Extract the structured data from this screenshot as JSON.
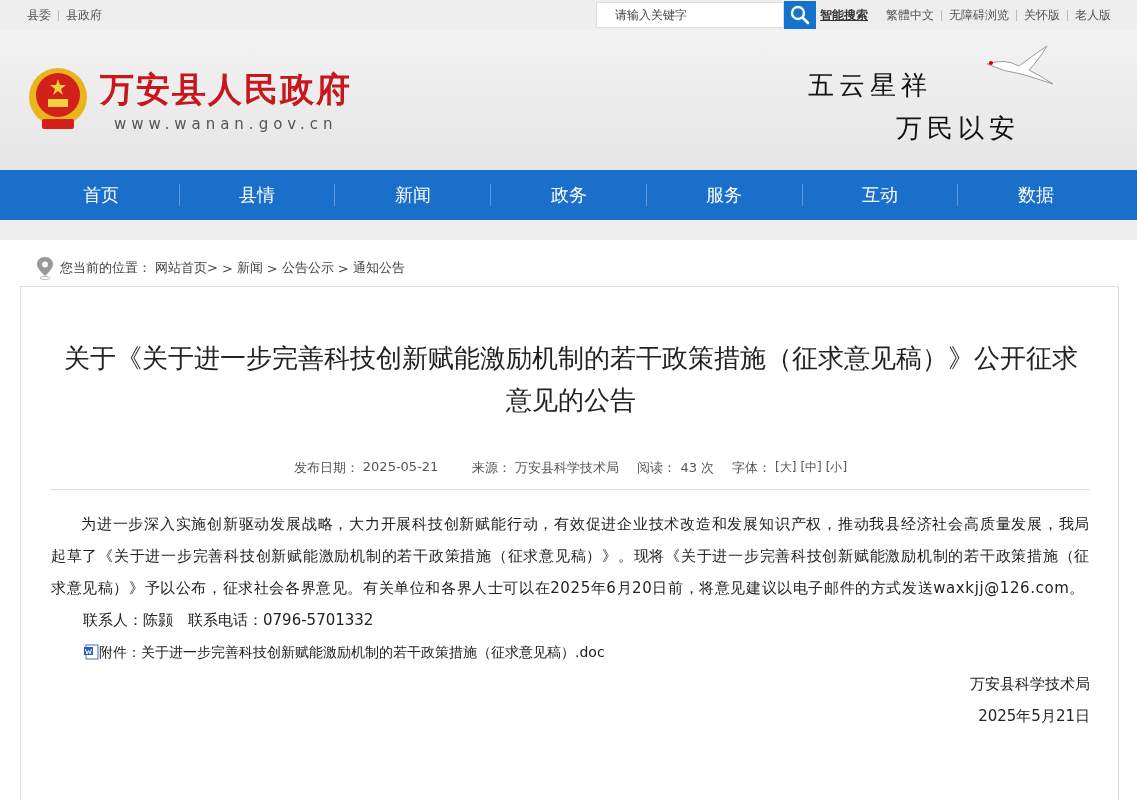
{
  "top_bar": {
    "left_links": [
      "县委",
      "县政府"
    ],
    "search": {
      "placeholder": "请输入关键字",
      "advanced_link": "智能搜索"
    },
    "right_links": [
      "繁體中文",
      "无障碍浏览",
      "关怀版",
      "老人版"
    ]
  },
  "header": {
    "site_name": "万安县人民政府",
    "domain": "www.wanan.gov.cn",
    "slogan_1": "五云星祥",
    "slogan_2": "万民以安"
  },
  "nav": [
    "首页",
    "县情",
    "新闻",
    "政务",
    "服务",
    "互动",
    "数据"
  ],
  "breadcrumb": {
    "label": "您当前的位置：",
    "items": [
      "网站首页>",
      ">",
      "新闻",
      ">",
      "公告公示",
      ">",
      "通知公告"
    ]
  },
  "article": {
    "title": "关于《关于进一步完善科技创新赋能激励机制的若干政策措施（征求意见稿）》公开征求意见的公告",
    "meta": {
      "date_label": "发布日期：",
      "date": "2025-05-21",
      "source_label": "来源：",
      "source": "万安县科学技术局",
      "reads_label": "阅读：",
      "reads": "43 次",
      "font_label": "字体：",
      "font_sizes": [
        "[大]",
        "[中]",
        "[小]"
      ]
    },
    "body": "为进一步深入实施创新驱动发展战略，大力开展科技创新赋能行动，有效促进企业技术改造和发展知识产权，推动我县经济社会高质量发展，我局起草了《关于进一步完善科技创新赋能激励机制的若干政策措施（征求意见稿）》。现将《关于进一步完善科技创新赋能激励机制的若干政策措施（征求意见稿）》予以公布，征求社会各界意见。有关单位和各界人士可以在2025年6月20日前，将意见建议以电子邮件的方式发送waxkjj@126.com。",
    "contact": "联系人：陈颢　联系电话：0796-5701332",
    "attachment": "附件：关于进一步完善科技创新赋能激励机制的若干政策措施（征求意见稿）.doc",
    "signature": "万安县科学技术局",
    "sign_date": "2025年5月21日"
  }
}
